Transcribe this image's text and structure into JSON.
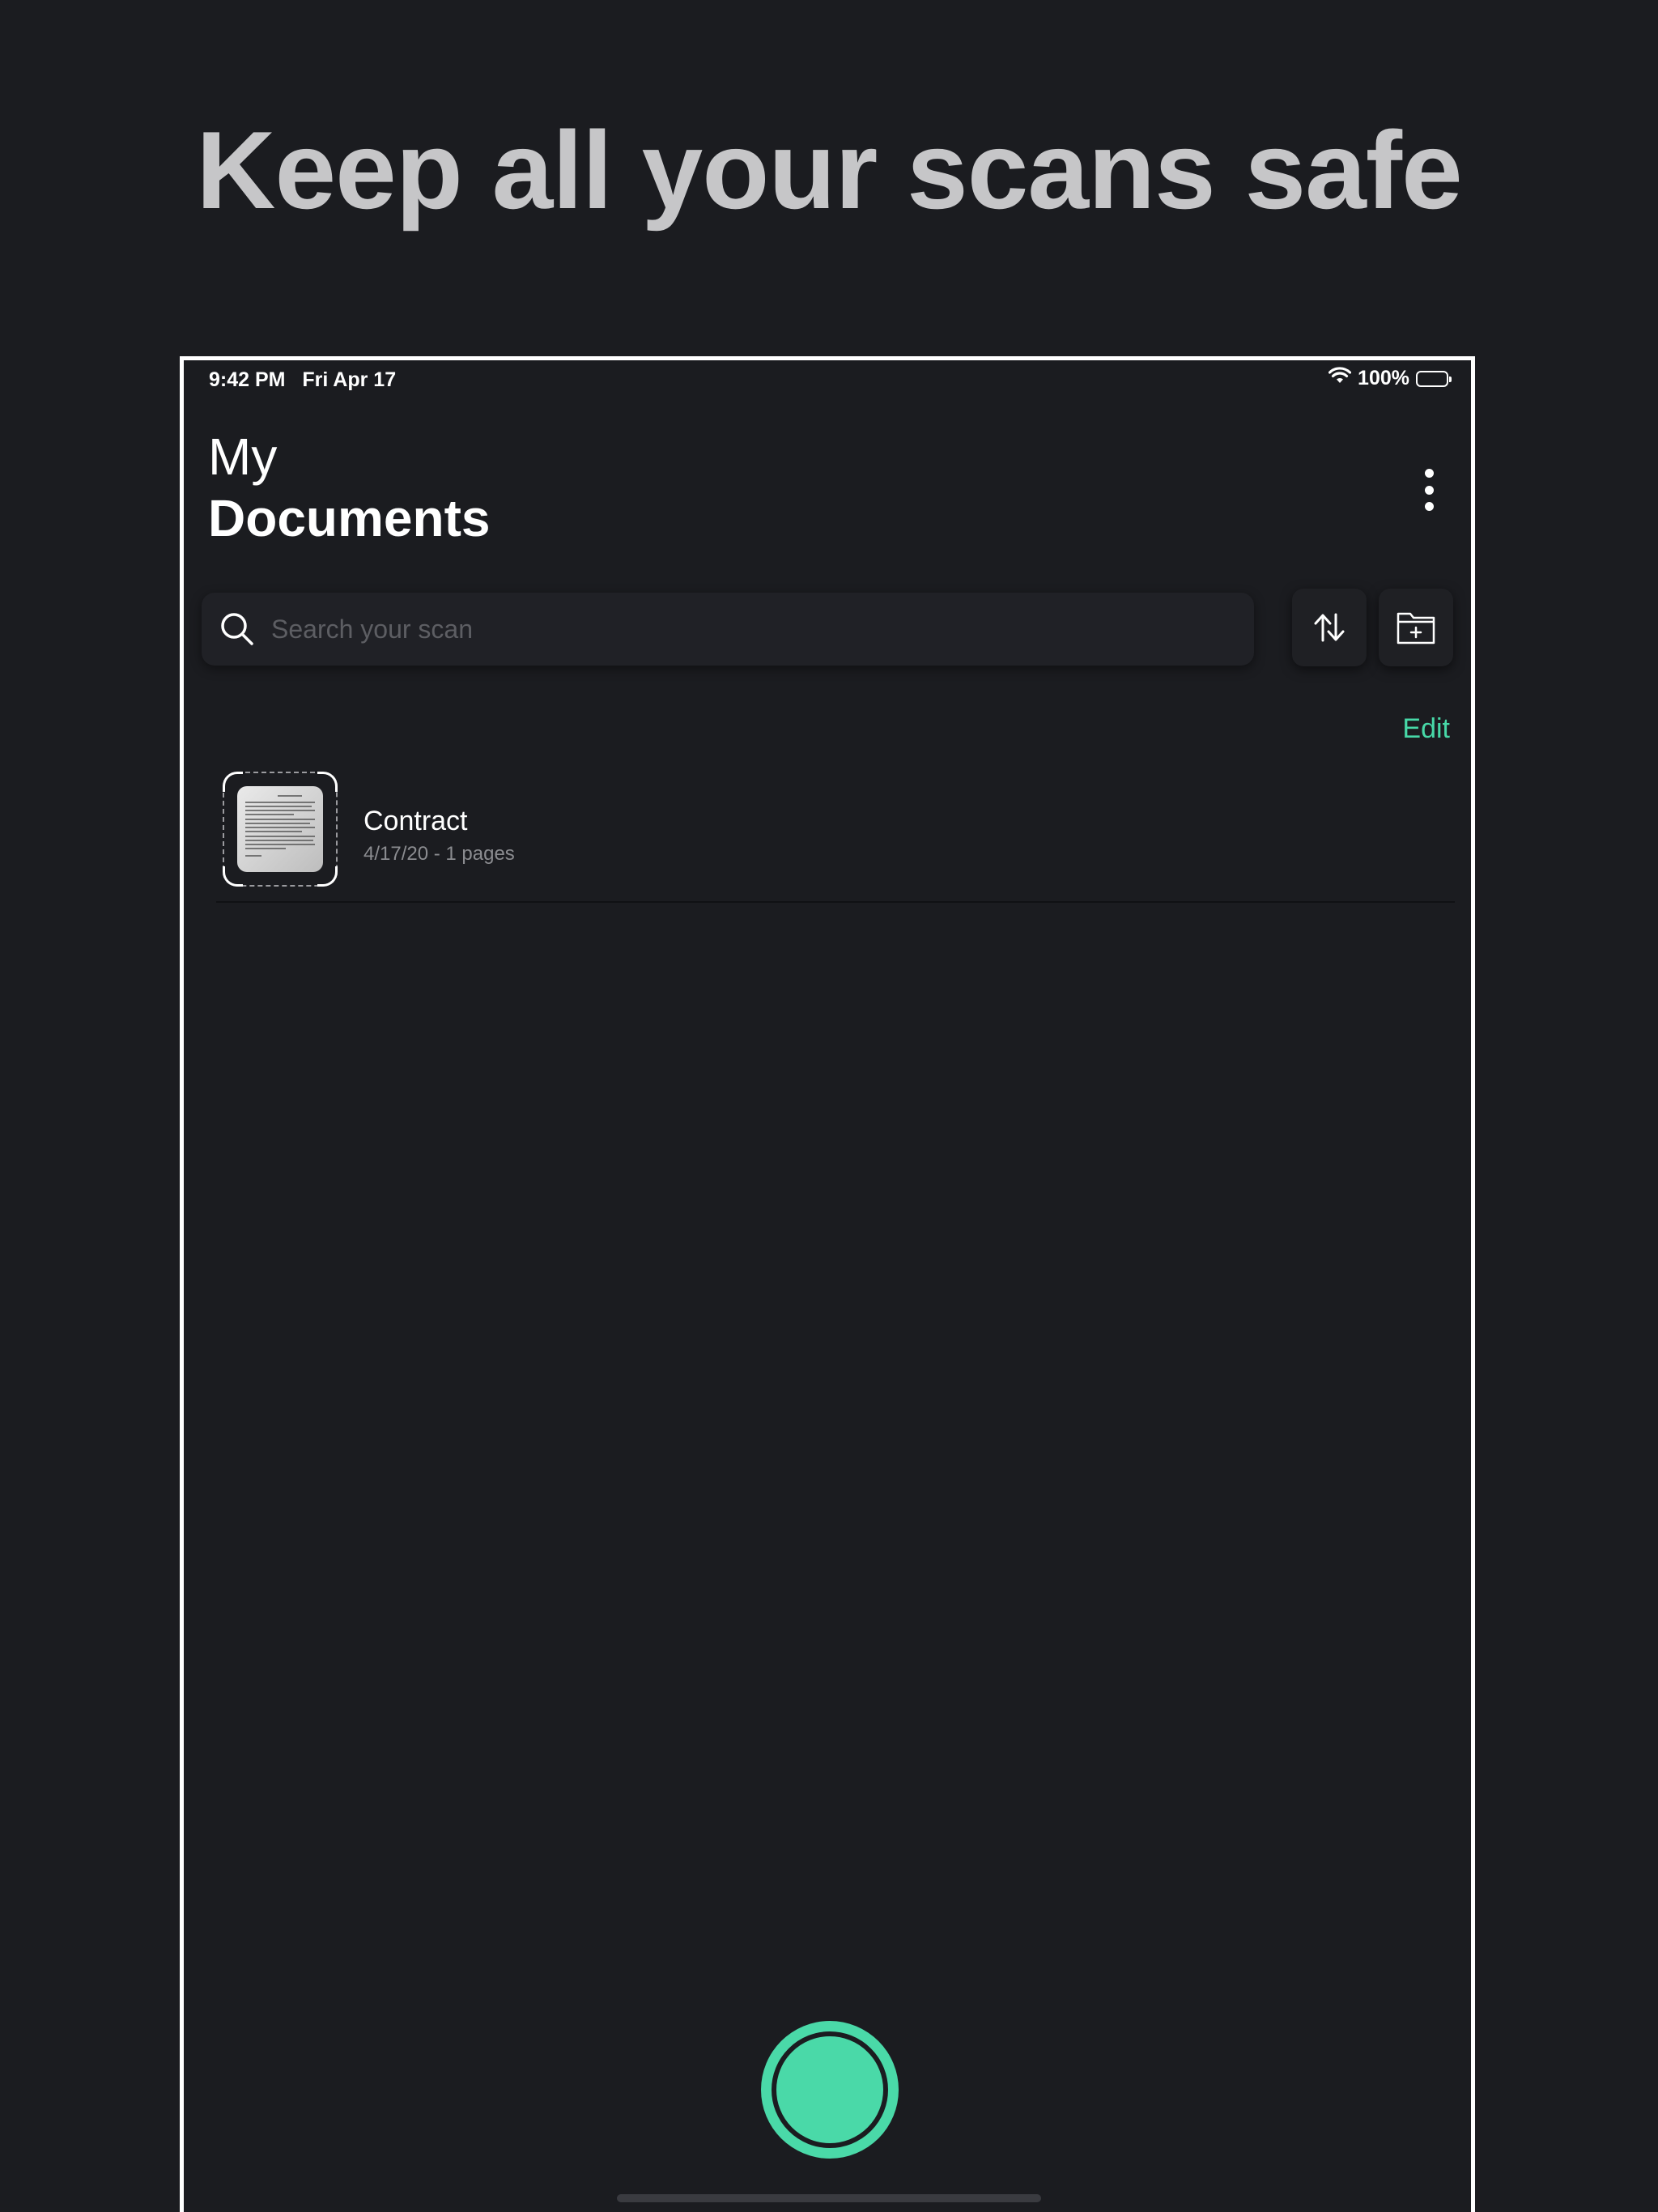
{
  "promo": {
    "headline": "Keep all your scans safe"
  },
  "status_bar": {
    "time": "9:42 PM",
    "date": "Fri Apr 17",
    "battery": "100%",
    "wifi_icon": "wifi-icon",
    "battery_icon": "battery-icon"
  },
  "header": {
    "title_light": "My",
    "title_bold": "Documents",
    "more_icon": "more-vertical-icon"
  },
  "search": {
    "placeholder": "Search your scan",
    "value": "",
    "icon": "search-icon"
  },
  "toolbar": {
    "sort_icon": "sort-arrows-icon",
    "new_folder_icon": "folder-plus-icon"
  },
  "list": {
    "edit_label": "Edit",
    "documents": [
      {
        "title": "Contract",
        "meta": "4/17/20 - 1 pages",
        "thumbnail_icon": "document-thumbnail"
      }
    ]
  },
  "actions": {
    "scan_icon": "camera-shutter-icon"
  },
  "colors": {
    "background": "#1b1c20",
    "accent": "#47d8a7",
    "text_primary": "#ffffff",
    "text_secondary": "#8b8c90",
    "headline": "#c6c6c8"
  }
}
